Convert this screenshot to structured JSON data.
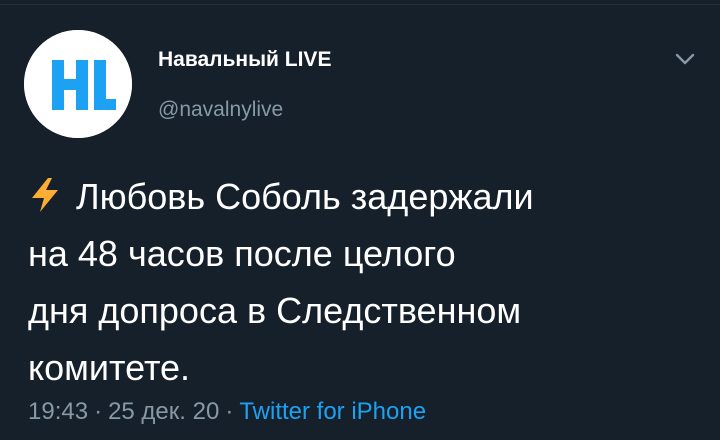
{
  "author": {
    "avatar_text": "HL",
    "display_name": "Навальный LIVE",
    "handle": "@navalnylive"
  },
  "tweet": {
    "lines": [
      "Любовь Соболь задержали",
      "на 48 часов после целого",
      "дня допроса в Следственном",
      "комитете."
    ],
    "leading_icon": "high-voltage-emoji"
  },
  "meta": {
    "time": "19:43",
    "date": "25 дек. 20",
    "separator": "·",
    "source": "Twitter for iPhone"
  },
  "colors": {
    "background": "#15202b",
    "text": "#ffffff",
    "secondary_text": "#8899a6",
    "link": "#1da1f2",
    "avatar_logo": "#1da1f2",
    "lightning": "#ffac33"
  }
}
